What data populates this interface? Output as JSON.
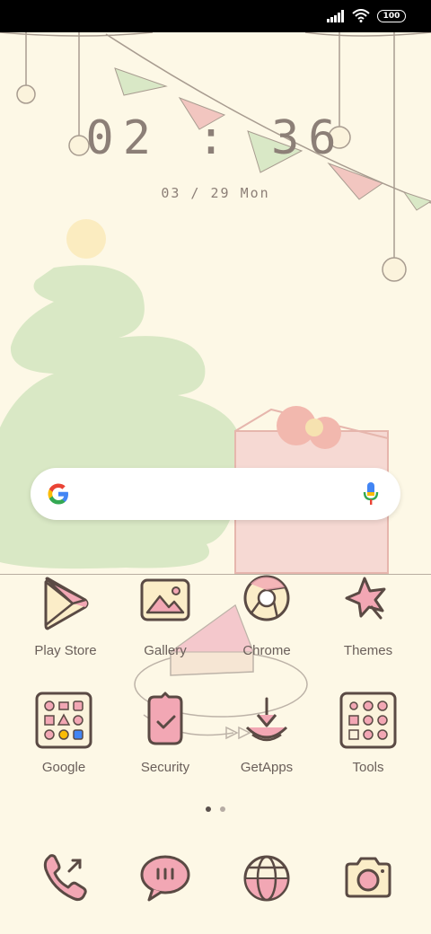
{
  "status_bar": {
    "battery": "100",
    "icons": [
      "signal-icon",
      "wifi-icon",
      "battery-icon"
    ]
  },
  "clock": {
    "time": "02 : 36",
    "date": "03 / 29 Mon"
  },
  "search": {
    "icons": [
      "google-g-icon",
      "microphone-icon"
    ]
  },
  "apps_row1": [
    {
      "label": "Play Store",
      "icon": "play-store-icon"
    },
    {
      "label": "Gallery",
      "icon": "gallery-icon"
    },
    {
      "label": "Chrome",
      "icon": "chrome-icon"
    },
    {
      "label": "Themes",
      "icon": "themes-icon"
    }
  ],
  "apps_row2": [
    {
      "label": "Google",
      "icon": "google-folder-icon"
    },
    {
      "label": "Security",
      "icon": "security-icon"
    },
    {
      "label": "GetApps",
      "icon": "getapps-icon"
    },
    {
      "label": "Tools",
      "icon": "tools-folder-icon"
    }
  ],
  "page_indicator": {
    "pages": 2,
    "current": 1
  },
  "dock": [
    {
      "icon": "phone-icon"
    },
    {
      "icon": "messages-icon"
    },
    {
      "icon": "browser-icon"
    },
    {
      "icon": "camera-icon"
    }
  ],
  "colors": {
    "background": "#fdf8e6",
    "icon_stroke": "#5a4a44",
    "icon_pink": "#f2a7b4",
    "icon_cream": "#fbedc8",
    "tree_green": "#d7e7c3",
    "text": "#6a5f5a"
  }
}
